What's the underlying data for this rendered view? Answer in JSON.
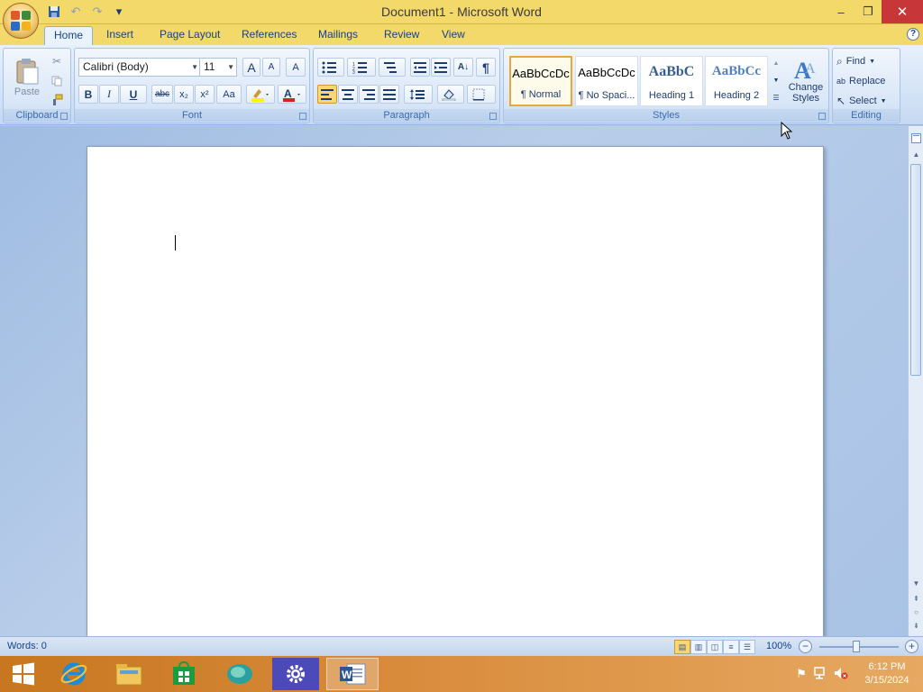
{
  "window": {
    "title": "Document1 - Microsoft Word",
    "minimize": "–",
    "restore": "❐",
    "close": "✕"
  },
  "quick_access": {
    "save_icon": "save-icon",
    "undo_icon": "undo-icon",
    "redo_icon": "redo-icon",
    "customize": "▾"
  },
  "tabs": [
    {
      "label": "Home",
      "active": true
    },
    {
      "label": "Insert"
    },
    {
      "label": "Page Layout"
    },
    {
      "label": "References"
    },
    {
      "label": "Mailings"
    },
    {
      "label": "Review"
    },
    {
      "label": "View"
    }
  ],
  "help": "?",
  "ribbon": {
    "clipboard": {
      "label": "Clipboard",
      "paste": "Paste"
    },
    "font": {
      "label": "Font",
      "font_name": "Calibri (Body)",
      "font_size": "11",
      "bold": "B",
      "italic": "I",
      "underline": "U",
      "strike": "abc",
      "subscript": "x₂",
      "superscript": "x²",
      "change_case": "Aa",
      "grow": "A",
      "shrink": "A",
      "clear": "A"
    },
    "paragraph": {
      "label": "Paragraph",
      "sort": "A↓",
      "show_marks": "¶"
    },
    "styles": {
      "label": "Styles",
      "items": [
        {
          "sample": "AaBbCcDc",
          "name": "¶ Normal",
          "selected": true
        },
        {
          "sample": "AaBbCcDc",
          "name": "¶ No Spaci..."
        },
        {
          "sample": "AaBbC",
          "name": "Heading 1"
        },
        {
          "sample": "AaBbCc",
          "name": "Heading 2"
        }
      ],
      "change_styles_line1": "Change",
      "change_styles_line2": "Styles"
    },
    "editing": {
      "label": "Editing",
      "find": "Find",
      "replace": "Replace",
      "select": "Select"
    }
  },
  "status": {
    "words": "Words: 0",
    "zoom": "100%",
    "zoom_level": 1.0,
    "minus": "−",
    "plus": "+"
  },
  "taskbar": {
    "time": "6:12 PM",
    "date": "3/15/2024"
  }
}
